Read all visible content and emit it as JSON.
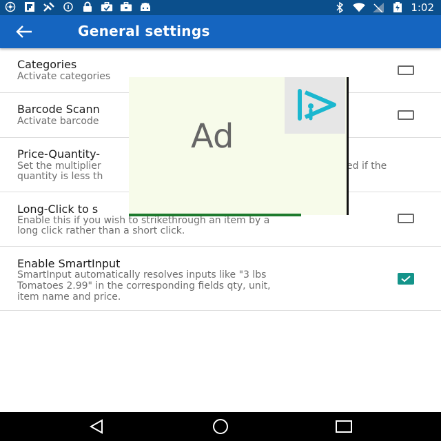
{
  "status_bar": {
    "time": "1:02",
    "icons_left": [
      "podcast-icon",
      "flipboard-icon",
      "satellite-icon",
      "data-saver-icon",
      "lock-icon",
      "briefcase-check-icon",
      "briefcase-icon",
      "android-icon"
    ],
    "icons_right": [
      "bluetooth-icon",
      "wifi-icon",
      "signal-icon",
      "battery-icon"
    ]
  },
  "app_bar": {
    "title": "General settings",
    "color": "#1565c0"
  },
  "settings": [
    {
      "title": "Categories",
      "subtitle": [
        "Activate categories"
      ],
      "checked": false
    },
    {
      "title": "Barcode Scann",
      "subtitle": [
        "Activate barcode"
      ],
      "checked": false
    },
    {
      "title": "Price-Quantity-",
      "subtitle_left": [
        "Set the multiplier",
        "quantity is less th"
      ],
      "subtitle_right": "ed if the"
    },
    {
      "title": "Long-Click to s",
      "subtitle": [
        "Enable this if you wish to strikethrough an item by a",
        "long click rather than a short click."
      ],
      "checked": false
    },
    {
      "title": "Enable SmartInput",
      "subtitle": [
        "SmartInput automatically resolves inputs like \"3 lbs",
        "Tomatoes 2.99\" in the corresponding fields qty, unit,",
        "item name and price."
      ],
      "checked": true
    }
  ],
  "ad": {
    "label": "Ad"
  },
  "colors": {
    "accent": "#14948a",
    "status_bar": "#0b4f8c"
  },
  "nav_bar": {
    "icons": [
      "back-triangle-icon",
      "home-circle-icon",
      "recents-square-icon"
    ]
  }
}
